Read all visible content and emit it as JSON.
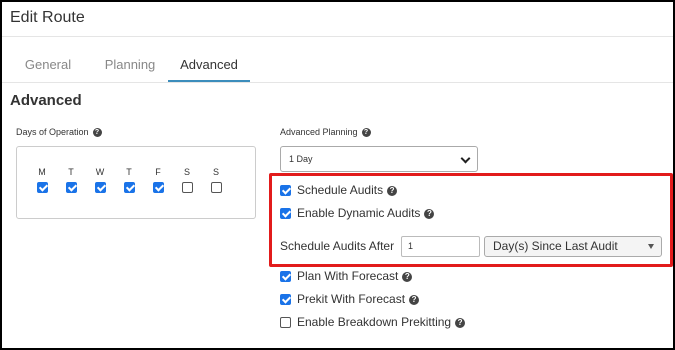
{
  "window": {
    "title": "Edit Route"
  },
  "tabs": [
    {
      "label": "General",
      "active": false
    },
    {
      "label": "Planning",
      "active": false
    },
    {
      "label": "Advanced",
      "active": true
    }
  ],
  "section": {
    "title": "Advanced"
  },
  "days_of_operation": {
    "label": "Days of Operation",
    "days": [
      {
        "letter": "M",
        "checked": true
      },
      {
        "letter": "T",
        "checked": true
      },
      {
        "letter": "W",
        "checked": true
      },
      {
        "letter": "T",
        "checked": true
      },
      {
        "letter": "F",
        "checked": true
      },
      {
        "letter": "S",
        "checked": false
      },
      {
        "letter": "S",
        "checked": false
      }
    ]
  },
  "advanced_planning": {
    "label": "Advanced Planning",
    "selected": "1 Day"
  },
  "options": {
    "schedule_audits": {
      "label": "Schedule Audits",
      "checked": true
    },
    "enable_dynamic_audits": {
      "label": "Enable Dynamic Audits",
      "checked": true
    },
    "schedule_audits_after": {
      "label": "Schedule Audits After",
      "value": "1",
      "unit": "Day(s) Since Last Audit"
    },
    "plan_with_forecast": {
      "label": "Plan With Forecast",
      "checked": true
    },
    "prekit_with_forecast": {
      "label": "Prekit With Forecast",
      "checked": true
    },
    "enable_breakdown_prekitting": {
      "label": "Enable Breakdown Prekitting",
      "checked": false
    }
  },
  "colors": {
    "accent": "#3c8dbc",
    "checkbox": "#1a73e8",
    "highlight": "#e21b1b"
  },
  "icons": {
    "help": "question-circle-icon",
    "dropdown": "chevron-down-icon"
  }
}
